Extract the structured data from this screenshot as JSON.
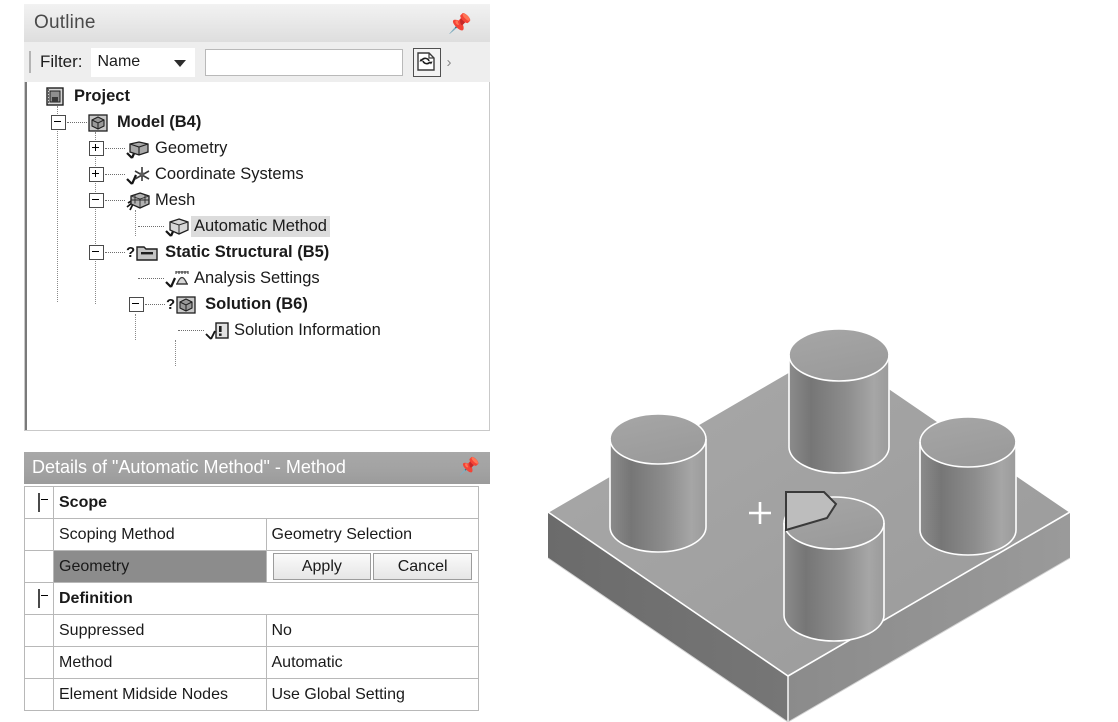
{
  "outline": {
    "title": "Outline",
    "pin_icon": "pushpin-icon",
    "filter": {
      "label": "Filter:",
      "select_value": "Name",
      "input_value": "",
      "input_placeholder": "",
      "refresh_icon": "refresh-icon",
      "overflow": "›"
    },
    "tree": [
      {
        "label": "Project",
        "icon": "project-icon",
        "bold": true,
        "expander": "none",
        "check": "none",
        "selected": false,
        "depth": 0
      },
      {
        "label": "Model (B4)",
        "icon": "model-icon",
        "bold": true,
        "expander": "minus",
        "check": "none",
        "selected": false,
        "depth": 1
      },
      {
        "label": "Geometry",
        "icon": "geometry-icon",
        "bold": false,
        "expander": "plus",
        "check": "check",
        "selected": false,
        "depth": 2
      },
      {
        "label": "Coordinate Systems",
        "icon": "coordinate-systems-icon",
        "bold": false,
        "expander": "plus",
        "check": "check",
        "selected": false,
        "depth": 2
      },
      {
        "label": "Mesh",
        "icon": "mesh-icon",
        "bold": false,
        "expander": "minus",
        "check": "refresh",
        "selected": false,
        "depth": 2
      },
      {
        "label": "Automatic Method",
        "icon": "method-icon",
        "bold": false,
        "expander": "none",
        "check": "check",
        "selected": true,
        "depth": 3
      },
      {
        "label": "Static Structural (B5)",
        "icon": "folder-icon",
        "bold": true,
        "expander": "minus",
        "check": "question",
        "selected": false,
        "depth": 2
      },
      {
        "label": "Analysis Settings",
        "icon": "analysis-settings-icon",
        "bold": false,
        "expander": "none",
        "check": "check",
        "selected": false,
        "depth": 3
      },
      {
        "label": "Solution (B6)",
        "icon": "solution-icon",
        "bold": true,
        "expander": "minus",
        "check": "question",
        "selected": false,
        "depth": 3
      },
      {
        "label": "Solution Information",
        "icon": "solution-info-icon",
        "bold": false,
        "expander": "none",
        "check": "refresh",
        "selected": false,
        "depth": 4
      }
    ]
  },
  "details": {
    "title": "Details of \"Automatic Method\" - Method",
    "pin_icon": "pushpin-icon",
    "rows": [
      {
        "kind": "group",
        "name": "Scope",
        "value": ""
      },
      {
        "kind": "prop",
        "name": "Scoping Method",
        "value": "Geometry Selection"
      },
      {
        "kind": "buttons",
        "name": "Geometry",
        "apply": "Apply",
        "cancel": "Cancel"
      },
      {
        "kind": "group",
        "name": "Definition",
        "value": ""
      },
      {
        "kind": "prop",
        "name": "Suppressed",
        "value": "No"
      },
      {
        "kind": "prop",
        "name": "Method",
        "value": "Automatic"
      },
      {
        "kind": "prop",
        "name": "Element Midside Nodes",
        "value": "Use Global Setting"
      }
    ]
  },
  "viewport": {
    "model_name": "four-stud-block",
    "cursor_icon": "crosshair-cursor",
    "selected_face_label": "selected-face",
    "colors": {
      "top_face": "#a2a2a2",
      "left_face": "#707070",
      "right_face": "#8e8e8e",
      "stud_top": "#a0a0a0",
      "stud_side_dark": "#7a7a7a",
      "stud_side_light": "#a5a5a5",
      "highlight_edge": "#ffffff",
      "selected_face": "#bdbdbd",
      "selected_outline": "#3a3a3a"
    }
  }
}
